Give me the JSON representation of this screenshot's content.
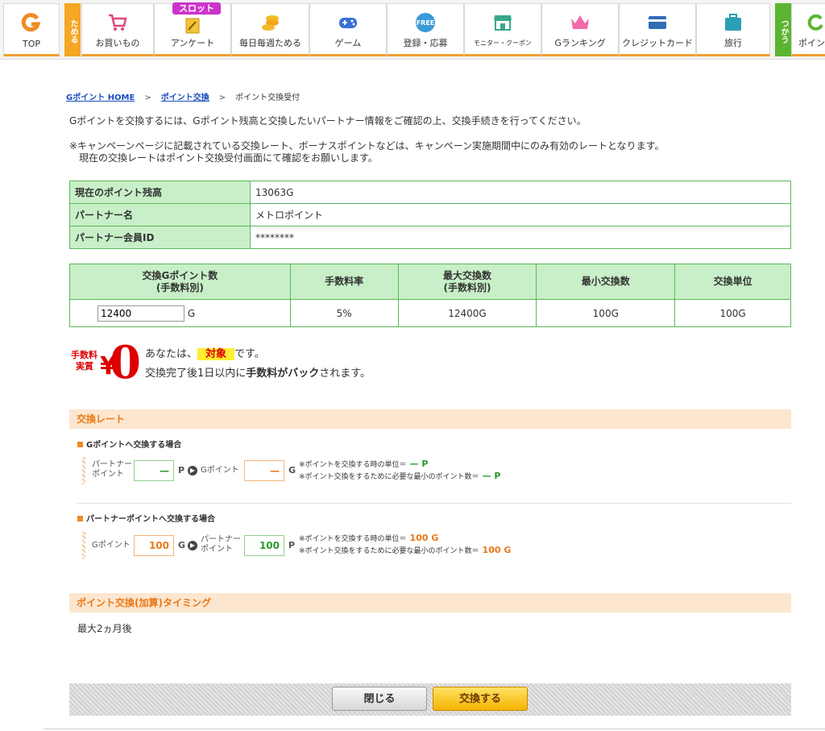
{
  "nav": {
    "top": "TOP",
    "tameru": "ためる",
    "tsukau": "つかう",
    "slot_badge": "スロット",
    "items": [
      {
        "label": "お買いもの",
        "icon": "cart-icon"
      },
      {
        "label": "アンケート",
        "icon": "survey-icon"
      },
      {
        "label": "毎日毎週ためる",
        "icon": "coins-icon"
      },
      {
        "label": "ゲーム",
        "icon": "gamepad-icon"
      },
      {
        "label": "登録・応募",
        "icon": "free-icon"
      },
      {
        "label": "モニター・クーポン",
        "icon": "shop-icon"
      },
      {
        "label": "Gランキング",
        "icon": "crown-icon"
      },
      {
        "label": "クレジットカード",
        "icon": "credit-card-icon"
      },
      {
        "label": "旅行",
        "icon": "suitcase-icon"
      },
      {
        "label": "ポイン",
        "icon": "exchange-icon"
      }
    ],
    "free_text": "FREE"
  },
  "breadcrumb": {
    "home": "Gポイント HOME",
    "sep": ">",
    "exchange": "ポイント交換",
    "current": "ポイント交換受付"
  },
  "intro": "Gポイントを交換するには、Gポイント残高と交換したいパートナー情報をご確認の上、交換手続きを行ってください。",
  "note_line1": "※キャンペーンページに記載されている交換レート、ボーナスポイントなどは、キャンペーン実施期間中にのみ有効のレートとなります。",
  "note_line2": "現在の交換レートはポイント交換受付画面にて確認をお願いします。",
  "info": {
    "balance_label": "現在のポイント残高",
    "balance_value": "13063G",
    "partner_label": "パートナー名",
    "partner_value": "メトロポイント",
    "member_label": "パートナー会員ID",
    "member_value": "********"
  },
  "exchange_table": {
    "headers": [
      "交換Gポイント数",
      "(手数料別)",
      "手数料率",
      "最大交換数",
      "(手数料別)",
      "最小交換数",
      "交換単位"
    ],
    "amount_value": "12400",
    "amount_unit": "G",
    "fee_rate": "5%",
    "max": "12400G",
    "min": "100G",
    "unit": "100G"
  },
  "fee_zero": {
    "badge_l1": "手数料",
    "badge_l2": "実質",
    "yen": "¥",
    "zero": "0",
    "line1_pre": "あなたは、",
    "line1_target": "対象",
    "line1_post": "です。",
    "line2_pre": "交換完了後1日以内に",
    "line2_bold": "手数料がバック",
    "line2_post": "されます。"
  },
  "rate_section": {
    "title": "交換レート",
    "to_g": {
      "heading": "Gポイントへ交換する場合",
      "partner_label_1": "パートナー",
      "partner_label_2": "ポイント",
      "partner_value": "—",
      "partner_unit": "P",
      "g_label": "Gポイント",
      "g_value": "—",
      "g_unit": "G",
      "note1": "※ポイントを交換する時の単位＝",
      "note1_value": "— P",
      "note2": "※ポイント交換をするために必要な最小のポイント数＝",
      "note2_value": "— P"
    },
    "to_partner": {
      "heading": "パートナーポイントへ交換する場合",
      "g_label": "Gポイント",
      "g_value": "100",
      "g_unit": "G",
      "partner_label_1": "パートナー",
      "partner_label_2": "ポイント",
      "partner_value": "100",
      "partner_unit": "P",
      "note1": "※ポイントを交換する時の単位＝",
      "note1_value": "100 G",
      "note2": "※ポイント交換をするために必要な最小のポイント数＝",
      "note2_value": "100 G"
    }
  },
  "timing": {
    "title": "ポイント交換(加算)タイミング",
    "value": "最大2ヵ月後"
  },
  "buttons": {
    "close": "閉じる",
    "exchange": "交換する"
  },
  "colors": {
    "green_border": "#5cb85c",
    "green_header": "#c8efc8",
    "orange_accent": "#e87817",
    "section_bg": "#fde6cf"
  }
}
